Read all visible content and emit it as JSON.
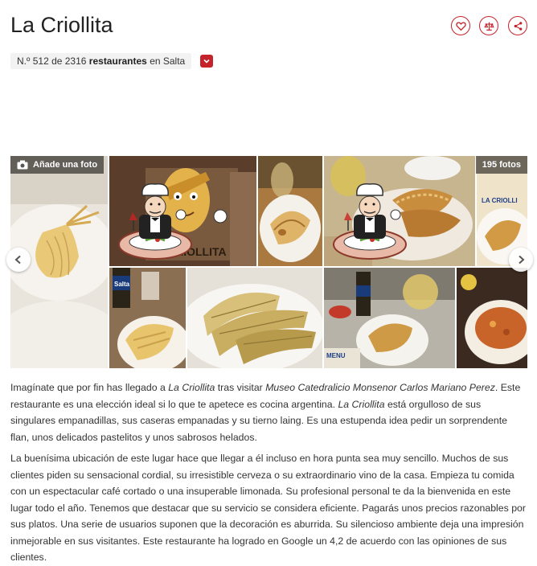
{
  "header": {
    "title": "La Criollita",
    "icons": [
      "heart-icon",
      "scale-icon",
      "share-icon"
    ],
    "accent_color": "#c4232b"
  },
  "rank": {
    "prefix": "N.º 512 de 2316",
    "category": "restaurantes",
    "suffix": "en Salta"
  },
  "gallery": {
    "add_photo_label": "Añade una foto",
    "photo_count_label": "195 fotos",
    "tiles": [
      "tamal",
      "mascot-sign",
      "empanada-plate",
      "empanadas-plate",
      "empanadas-right",
      "beer-bottle",
      "humitas",
      "tamales",
      "beer-table",
      "food-plate"
    ],
    "sign_text": "CRIOLLITA",
    "menu_text": "LA CRIOLLI",
    "beer_label": "Salta",
    "menu_word": "MENU"
  },
  "description": {
    "p1": {
      "t1": "Imagínate que por fin has llegado a ",
      "name1": "La Criollita",
      "t2": " tras visitar ",
      "museum": "Museo Catedralicio Monsenor Carlos Mariano Perez",
      "t3": ". Este restaurante es una elección ideal si lo que te apetece es cocina argentina. ",
      "name2": "La Criollita",
      "t4": " está orgulloso de sus singulares empanadillas, sus caseras empanadas y su tierno laing. Es una estupenda idea pedir un sorprendente flan, unos delicados pastelitos y unos sabrosos helados."
    },
    "p2": "La buenísima ubicación de este lugar hace que llegar a él incluso en hora punta sea muy sencillo. Muchos de sus clientes piden su sensacional cordial, su irresistible cerveza o su extraordinario vino de la casa. Empieza tu comida con un espectacular café cortado o una insuperable limonada. Su profesional personal te da la bienvenida en este lugar todo el año. Tenemos que destacar que su servicio se considera eficiente. Pagarás unos precios razonables por sus platos. Una serie de usuarios suponen que la decoración es aburrida. Su silencioso ambiente deja una impresión inmejorable en sus visitantes. Este restaurante ha logrado en Google un 4,2 de acuerdo con las opiniones de sus clientes."
  }
}
